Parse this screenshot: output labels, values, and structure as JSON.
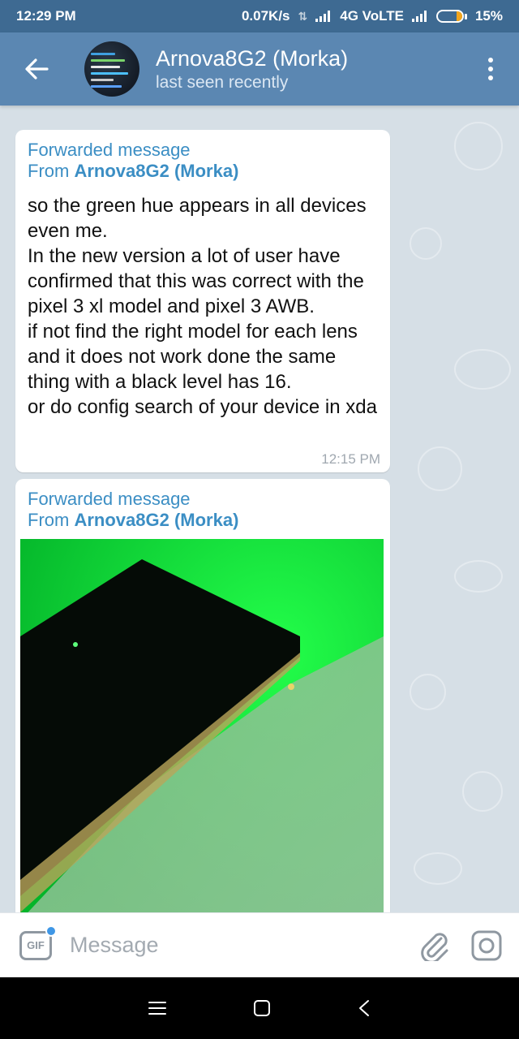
{
  "status_bar": {
    "time": "12:29 PM",
    "network_speed": "0.07K/s",
    "network_type": "4G VoLTE",
    "battery": "15%"
  },
  "header": {
    "name": "Arnova8G2 (Morka)",
    "status": "last seen recently"
  },
  "messages": [
    {
      "forwarded_label": "Forwarded message",
      "from_prefix": "From",
      "from_name": "Arnova8G2 (Morka)",
      "text": "so the green hue appears in all devices even me.\nIn the new version a lot of user have confirmed that this was correct with the pixel 3 xl model and pixel 3 AWB.\nif not find the right model for each lens and it does not work done the same thing with a black level has 16.\nor do config search of your device in xda",
      "time": "12:15 PM"
    },
    {
      "forwarded_label": "Forwarded message",
      "from_prefix": "From",
      "from_name": "Arnova8G2 (Morka)"
    }
  ],
  "input": {
    "gif_label": "GIF",
    "placeholder": "Message"
  },
  "colors": {
    "status_bar": "#3e6a92",
    "app_bar": "#5b87b2",
    "accent": "#3b8ec4",
    "chat_bg": "#d6dfe6"
  }
}
